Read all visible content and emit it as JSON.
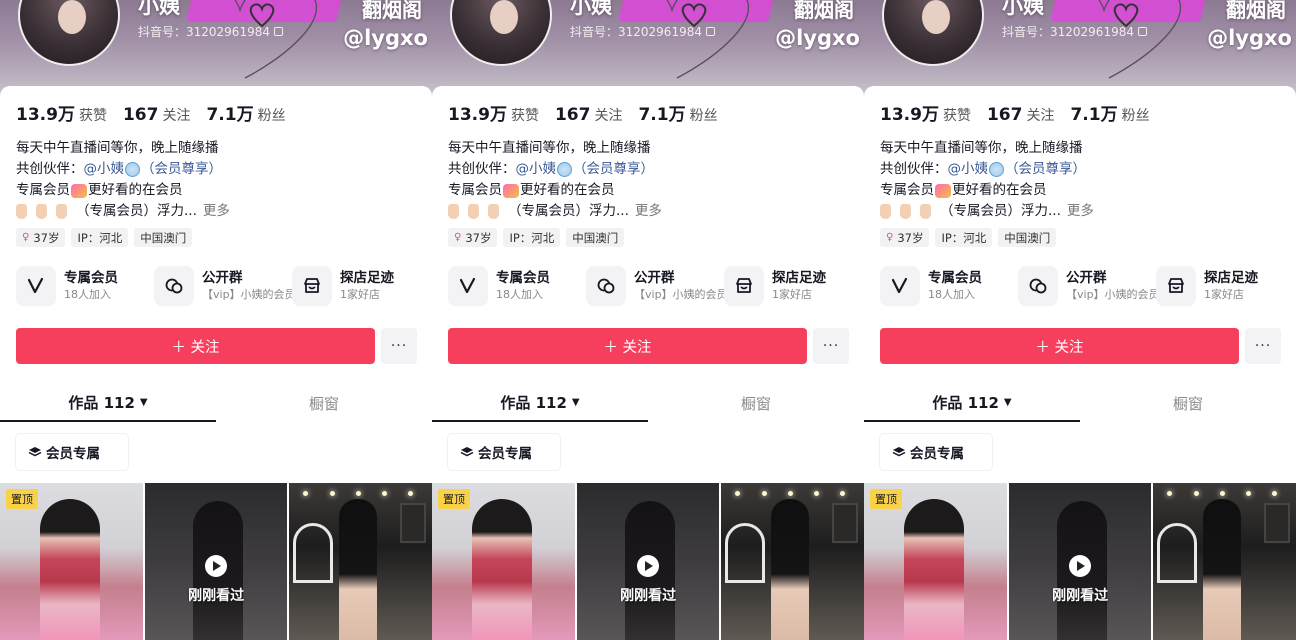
{
  "profile": {
    "nickname": "小姨",
    "douyin_id": "抖音号：31202961984",
    "watermark_top": "翻烟阁",
    "watermark_handle": "@lygxo"
  },
  "stats": [
    {
      "num": "13.9万",
      "label": "获赞"
    },
    {
      "num": "167",
      "label": "关注"
    },
    {
      "num": "7.1万",
      "label": "粉丝"
    }
  ],
  "bio": {
    "line1": "每天中午直播间等你，晚上随缘播",
    "line2_prefix": "共创伙伴：",
    "line2_link": "@小姨",
    "line2_suffix": "（会员尊享）",
    "line3_prefix": "专属会员",
    "line3_suffix": "更好看的在会员",
    "line4": "（专属会员）浮力...",
    "more": "更多"
  },
  "tags": [
    {
      "icon": "female-icon",
      "symbol": "♀",
      "text": "37岁"
    },
    {
      "text": "IP：河北"
    },
    {
      "text": "中国澳门"
    }
  ],
  "features": [
    {
      "icon": "vip-v-icon",
      "title": "专属会员",
      "sub": "18人加入"
    },
    {
      "icon": "group-chat-icon",
      "title": "公开群",
      "sub": "【vip】小姨的会员..."
    },
    {
      "icon": "shop-icon",
      "title": "探店足迹",
      "sub": "1家好店"
    }
  ],
  "actions": {
    "follow": "＋ 关注",
    "more": "···"
  },
  "tabs": {
    "works": "作品 112",
    "window": "橱窗"
  },
  "filter": "会员专属",
  "videos": [
    {
      "badge": "置顶"
    },
    {
      "overlay": "刚刚看过"
    },
    {}
  ],
  "colors": {
    "follow_button": "#f53f5c",
    "pin_badge": "#fad24a",
    "link": "#3b5998"
  }
}
